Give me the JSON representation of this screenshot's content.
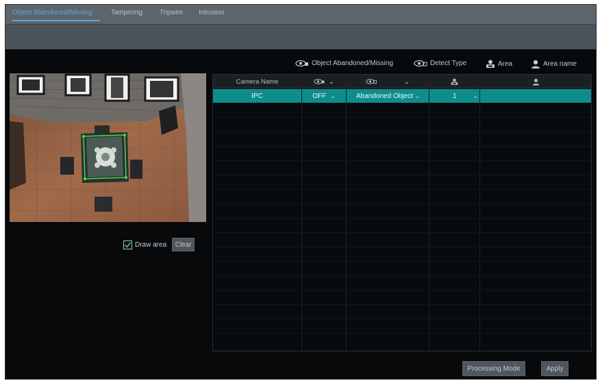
{
  "tabs": [
    {
      "label": "Object Abandoned/Missing",
      "active": true
    },
    {
      "label": "Tampering",
      "active": false
    },
    {
      "label": "Tripwire",
      "active": false
    },
    {
      "label": "Intrusion",
      "active": false
    }
  ],
  "legend": {
    "abandoned_missing": "Object Abandoned/Missing",
    "detect_type": "Detect Type",
    "area": "Area",
    "area_name": "Area name"
  },
  "table": {
    "columns": {
      "camera_name": "Camera Name"
    },
    "row": {
      "camera": "IPC",
      "enable": "OFF",
      "detect_type": "Abandoned Object",
      "area": "1",
      "area_name": ""
    }
  },
  "draw_area": {
    "label": "Draw area",
    "checked": true
  },
  "buttons": {
    "clear": "Clear",
    "processing_mode": "Processing Mode",
    "apply": "Apply"
  },
  "colors": {
    "accent": "#5aa9d6",
    "row_selected": "#0f8c8c",
    "detection_box": "#3ddc3d"
  }
}
